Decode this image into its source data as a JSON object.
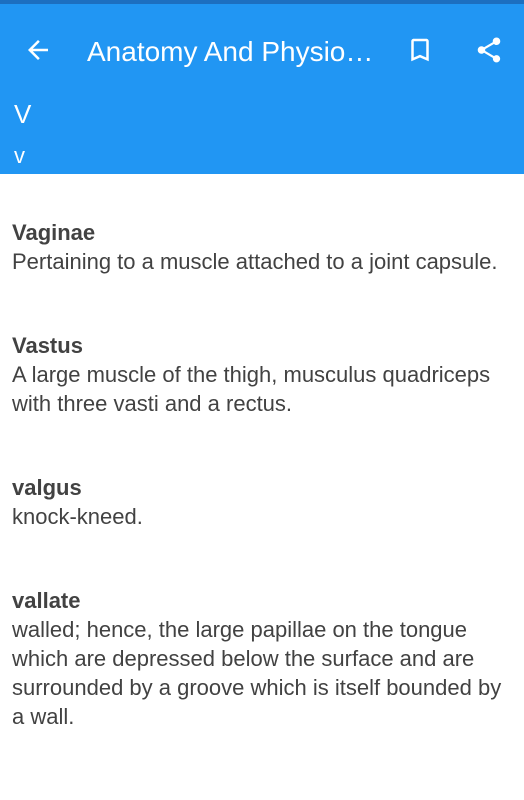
{
  "app_bar": {
    "title": "Anatomy And Physio…",
    "letter_upper": "V",
    "letter_lower": "v"
  },
  "icons": {
    "back": "arrow-back-icon",
    "bookmark": "bookmark-icon",
    "share": "share-icon"
  },
  "colors": {
    "app_bar": "#2196f3",
    "text": "#424242"
  },
  "entries": [
    {
      "term": "Vaginae",
      "definition": "Pertaining to a muscle attached to a joint capsule."
    },
    {
      "term": "Vastus",
      "definition": "A large muscle of the thigh, musculus quadriceps with three vasti and a rectus."
    },
    {
      "term": "valgus",
      "definition": "knock-kneed."
    },
    {
      "term": "vallate",
      "definition": "walled; hence, the large papillae on the tongue which are depressed below the surface and are surrounded by a groove which is itself bounded by a wall."
    }
  ]
}
